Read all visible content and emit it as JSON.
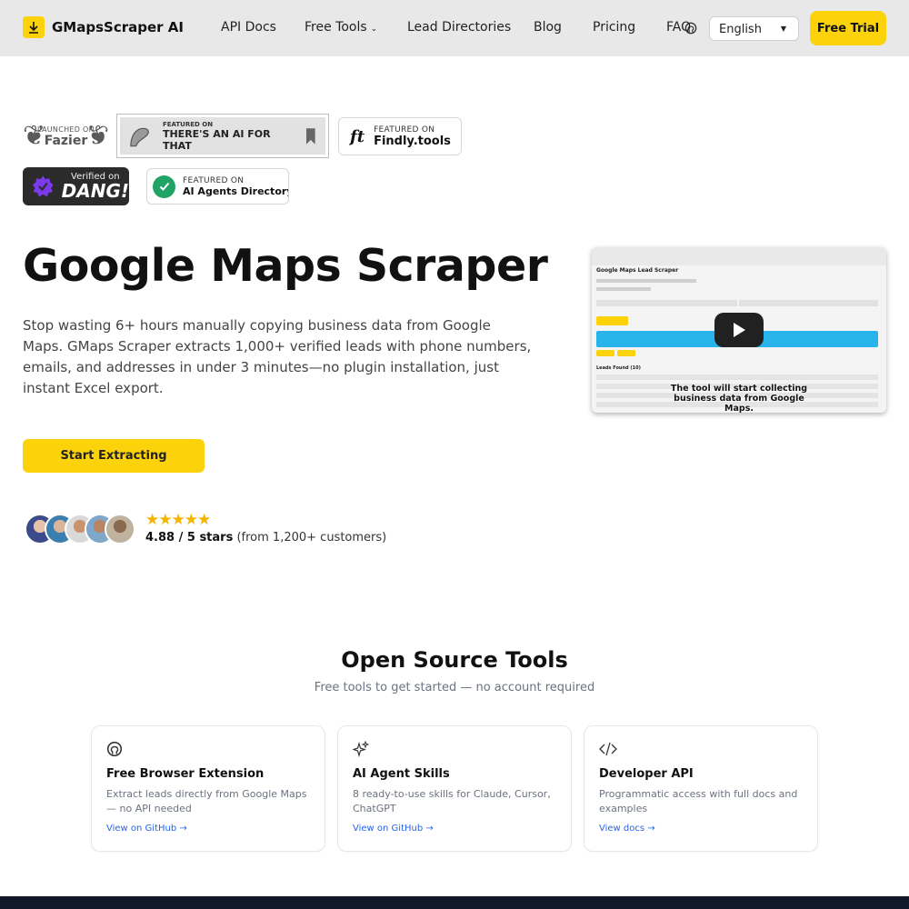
{
  "brand": {
    "name": "GMapsScraper AI",
    "accent": "#fcd20b"
  },
  "nav": {
    "links": [
      "API Docs",
      "Free Tools",
      "Lead Directories",
      "Blog",
      "Pricing",
      "FAQ"
    ],
    "language": "English",
    "trial_label": "Free Trial"
  },
  "badges": {
    "fazier": {
      "small": "LAUNCHED ON",
      "big": "Fazier"
    },
    "aifor": {
      "small": "FEATURED ON",
      "big": "THERE'S AN AI FOR THAT"
    },
    "findly": {
      "small": "FEATURED ON",
      "big": "Findly.tools"
    },
    "dang": {
      "small": "Verified on",
      "big": "DANG!"
    },
    "agents": {
      "small": "FEATURED ON",
      "big": "AI Agents Directory"
    }
  },
  "hero": {
    "title": "Google Maps Scraper",
    "description": "Stop wasting 6+ hours manually copying business data from Google Maps. GMaps Scraper extracts 1,000+ verified leads with phone numbers, emails, and addresses in under 3 minutes—no plugin installation, just instant Excel export.",
    "cta_label": "Start Extracting",
    "stars": "★★★★★",
    "rating_value": "4.88 / 5 stars",
    "rating_note": "(from 1,200+ customers)"
  },
  "video": {
    "app_title": "Google Maps Lead Scraper",
    "leads_label": "Leads Found (10)",
    "caption": "The tool will start collecting business data from Google Maps."
  },
  "open_source": {
    "title": "Open Source Tools",
    "subtitle": "Free tools to get started — no account required",
    "cards": [
      {
        "icon": "github-icon",
        "title": "Free Browser Extension",
        "desc": "Extract leads directly from Google Maps — no API needed",
        "link": "View on GitHub →"
      },
      {
        "icon": "sparkles-icon",
        "title": "AI Agent Skills",
        "desc": "8 ready-to-use skills for Claude, Cursor, ChatGPT",
        "link": "View on GitHub →"
      },
      {
        "icon": "code-icon",
        "title": "Developer API",
        "desc": "Programmatic access with full docs and examples",
        "link": "View docs →"
      }
    ]
  }
}
